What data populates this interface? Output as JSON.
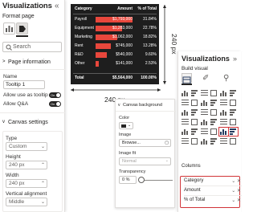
{
  "format_pane": {
    "title": "Visualizations",
    "collapse": "«",
    "subtitle": "Format page",
    "search_placeholder": "Search",
    "page_info": {
      "header": "Page information",
      "name_label": "Name",
      "name_value": "Tooltip 1",
      "tooltip_label": "Allow use as tooltip",
      "tooltip_toggle": "On",
      "qa_label": "Allow Q&A",
      "qa_toggle": "On"
    },
    "canvas": {
      "header": "Canvas settings",
      "type_label": "Type",
      "type_value": "Custom",
      "height_label": "Height",
      "height_value": "240 px",
      "width_label": "Width",
      "width_value": "240 px",
      "valign_label": "Vertical alignment",
      "valign_value": "Middle"
    }
  },
  "table": {
    "headers": [
      "Category",
      "Amount",
      "% of Total"
    ],
    "rows": [
      {
        "category": "Payroll",
        "amount": "$1,793,000",
        "pct": "31.84%",
        "bar": 1.0
      },
      {
        "category": "Equipment",
        "amount": "$1,283,000",
        "pct": "22.78%",
        "bar": 0.72
      },
      {
        "category": "Marketing",
        "amount": "$1,062,000",
        "pct": "18.82%",
        "bar": 0.59
      },
      {
        "category": "Rent",
        "amount": "$745,000",
        "pct": "13.28%",
        "bar": 0.42
      },
      {
        "category": "R&D",
        "amount": "$540,000",
        "pct": "9.60%",
        "bar": 0.3
      },
      {
        "category": "Other",
        "amount": "$141,000",
        "pct": "2.53%",
        "bar": 0.08
      }
    ],
    "total": {
      "category": "Total",
      "amount": "$5,564,000",
      "pct": "100.00%"
    }
  },
  "dims": {
    "width": "240 px",
    "height": "240 px"
  },
  "canvas_bg": {
    "header": "Canvas background",
    "color_label": "Color",
    "image_label": "Image",
    "image_value": "Browse...",
    "fit_label": "Image fit",
    "fit_value": "Normal",
    "transparency_label": "Transparency",
    "transparency_value": "0 %"
  },
  "viz_pane": {
    "title": "Visualizations",
    "collapse": "»",
    "subtitle": "Build visual",
    "columns_label": "Columns",
    "fields": [
      "Category",
      "Amount",
      "% of Total"
    ]
  },
  "colors": {
    "accent_red": "#d13438",
    "bar": "#e8473c",
    "table_bg": "#1e1e1e"
  }
}
